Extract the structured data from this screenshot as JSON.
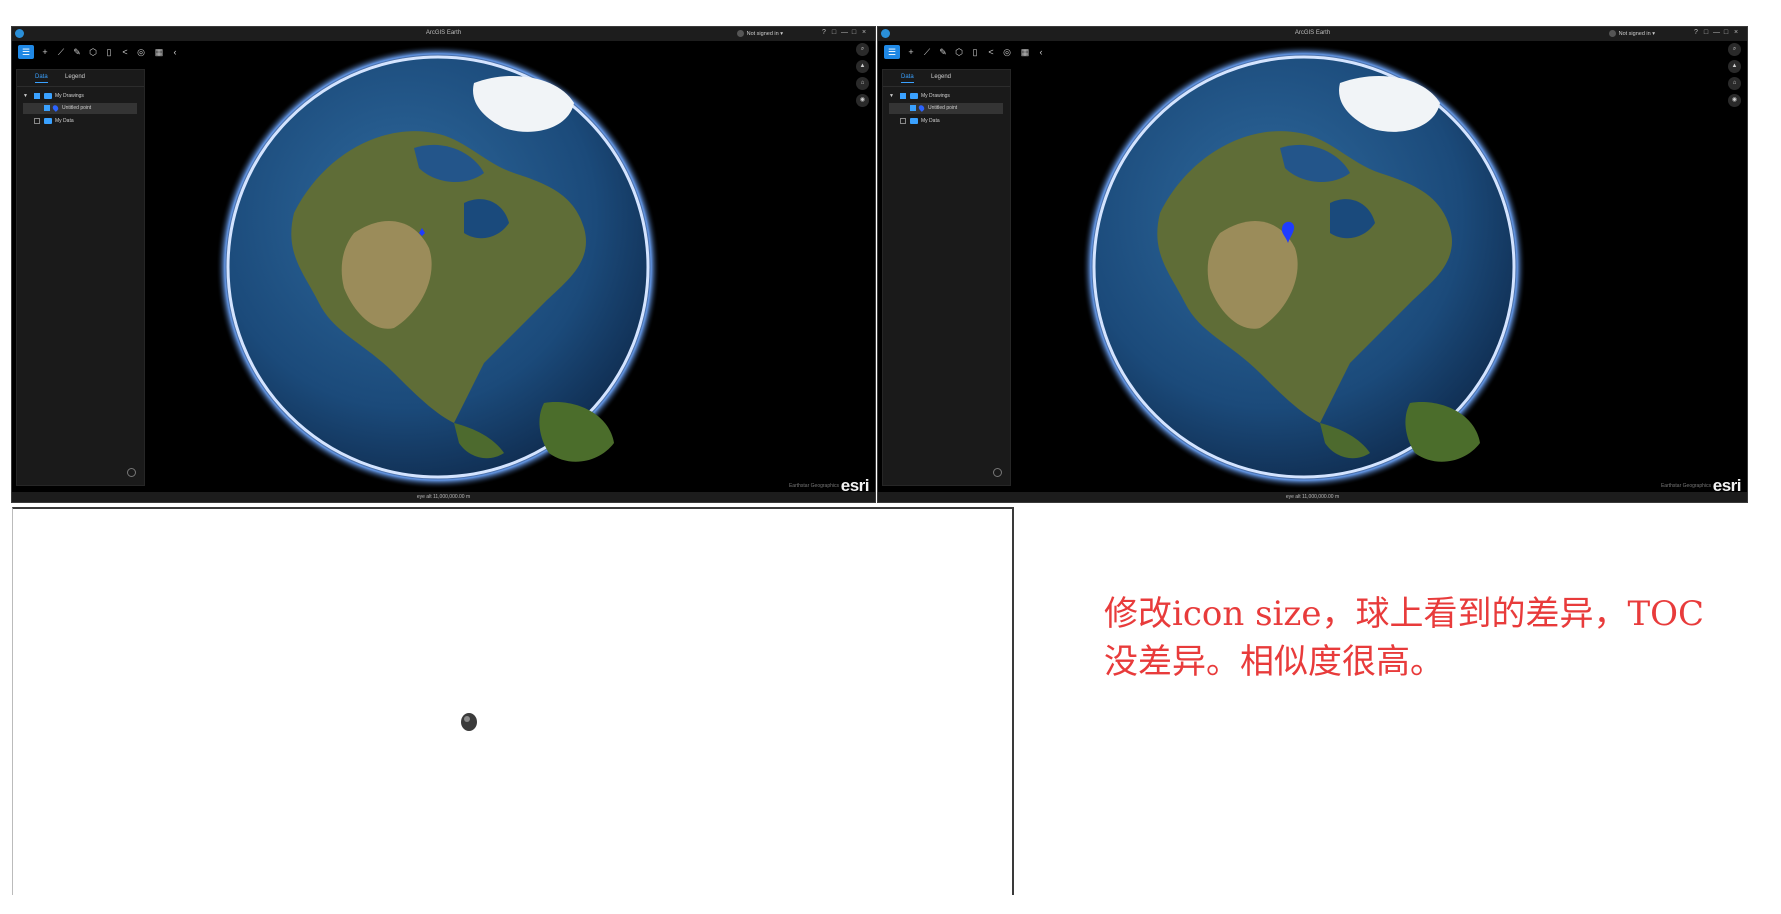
{
  "app": {
    "title": "ArcGIS Earth",
    "signin": "Not signed in ▾",
    "window_controls": [
      "?",
      "□",
      "—",
      "□",
      "×"
    ]
  },
  "toolbar": {
    "tools": [
      "☰",
      "+",
      "⟋",
      "✎",
      "⬡",
      "▯",
      "<",
      "◎",
      "▦",
      "‹"
    ]
  },
  "toc": {
    "tabs": [
      "Data",
      "Legend"
    ],
    "active_tab": "Data",
    "items": [
      {
        "label": "My Drawings",
        "type": "folder",
        "checked": true,
        "expanded": true
      },
      {
        "label": "Untitled point",
        "type": "point",
        "checked": true,
        "selected": true
      },
      {
        "label": "My Data",
        "type": "folder",
        "checked": false
      }
    ]
  },
  "map": {
    "attribution": "Earthstar Geographics",
    "brand": "esri",
    "status": "eye alt 11,000,000.00 m",
    "nav_buttons": [
      "search",
      "compass",
      "home",
      "camera"
    ]
  },
  "note": {
    "line1": "修改icon size，球上看到的差异，TOC",
    "line2": "没差异。相似度很高。"
  },
  "colors": {
    "accent": "#3aa1ff",
    "note": "#e83b3b",
    "ocean": "#1e4a7a",
    "land": "#6b7a3e",
    "marker": "#1f3cff"
  }
}
